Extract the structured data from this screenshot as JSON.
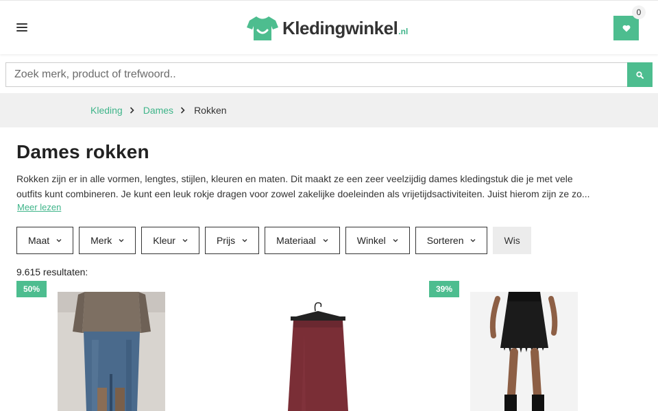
{
  "header": {
    "logo_text": "Kledingwinkel",
    "logo_tld": ".nl",
    "wishlist_count": "0",
    "icons": {
      "menu": "hamburger-menu-icon",
      "wishlist": "heart-icon",
      "logo": "t-shirt-logo-icon"
    },
    "colors": {
      "accent": "#4dbd8f",
      "text": "#333333"
    }
  },
  "search": {
    "placeholder": "Zoek merk, product of trefwoord..",
    "value": "",
    "icon": "search-icon"
  },
  "breadcrumb": {
    "items": [
      "Kleding",
      "Dames"
    ],
    "current": "Rokken"
  },
  "page": {
    "title": "Dames rokken",
    "description_line1": "Rokken zijn er in alle vormen, lengtes, stijlen, kleuren en maten. Dit maakt ze een zeer veelzijdig dames kledingstuk die je met vele",
    "description_line2": "outfits kunt combineren. Je kunt een leuk rokje dragen voor zowel zakelijke doeleinden als vrijetijdsactiviteiten. Juist hierom zijn ze zo...",
    "read_more": "Meer lezen"
  },
  "filters": {
    "items": [
      "Maat",
      "Merk",
      "Kleur",
      "Prijs",
      "Materiaal",
      "Winkel",
      "Sorteren"
    ],
    "clear_label": "Wis"
  },
  "results": {
    "count_text": "9.615 resultaten:"
  },
  "products": [
    {
      "badge": "50%",
      "image": "denim-midi-skirt-photo"
    },
    {
      "badge": "",
      "image": "burgundy-skirt-on-hanger-photo"
    },
    {
      "badge": "39%",
      "image": "black-fringe-mini-skirt-photo"
    }
  ]
}
